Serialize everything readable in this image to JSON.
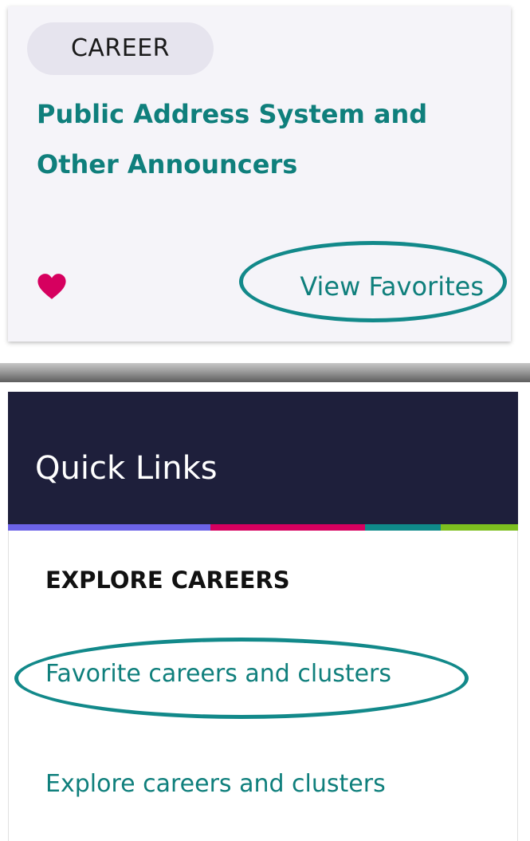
{
  "career_card": {
    "tag": "CAREER",
    "title": "Public Address System and Other Announcers",
    "view_favorites_label": "View Favorites",
    "favorite_icon": "heart-icon",
    "heart_color": "#d6005f",
    "accent_color": "#0f7f7c"
  },
  "quick_links": {
    "title": "Quick Links",
    "header_color": "#1e1f3b",
    "stripe_colors": [
      "#6c63e8",
      "#d6005f",
      "#0f8a8a",
      "#7dbf1f"
    ],
    "section_heading": "EXPLORE CAREERS",
    "links": [
      {
        "label": "Favorite careers and clusters"
      },
      {
        "label": "Explore careers and clusters"
      }
    ]
  }
}
